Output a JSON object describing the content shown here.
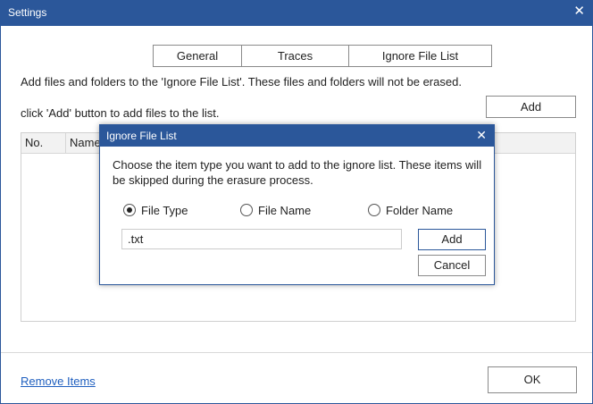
{
  "window": {
    "title": "Settings",
    "close_glyph": "✕"
  },
  "tabs": [
    {
      "label": "General"
    },
    {
      "label": "Traces"
    },
    {
      "label": "Ignore File List"
    }
  ],
  "description": {
    "line1": "Add files and folders to the 'Ignore File List'. These files and folders will not be erased.",
    "line2": "click 'Add' button to add files to the list."
  },
  "add_button_label": "Add",
  "list": {
    "columns": [
      "No.",
      "Name"
    ]
  },
  "footer": {
    "remove_link": "Remove Items",
    "ok_label": "OK"
  },
  "dialog": {
    "title": "Ignore File List",
    "close_glyph": "✕",
    "message": "Choose the item type you want to add to the ignore list. These items will be skipped during the erasure process.",
    "options": [
      {
        "label": "File Type",
        "selected": true
      },
      {
        "label": "File Name",
        "selected": false
      },
      {
        "label": "Folder Name",
        "selected": false
      }
    ],
    "input_value": ".txt",
    "add_label": "Add",
    "cancel_label": "Cancel"
  },
  "colors": {
    "accent": "#2b579a",
    "link": "#1f5fbf"
  }
}
